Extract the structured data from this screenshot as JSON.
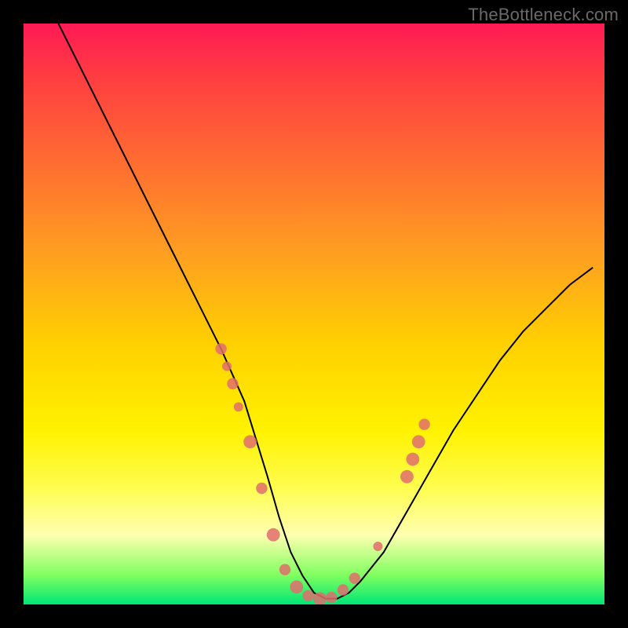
{
  "watermark": "TheBottleneck.com",
  "chart_data": {
    "type": "line",
    "title": "",
    "xlabel": "",
    "ylabel": "",
    "xlim": [
      0,
      100
    ],
    "ylim": [
      0,
      100
    ],
    "grid": false,
    "legend": false,
    "series": [
      {
        "name": "bottleneck-curve",
        "x": [
          6,
          10,
          14,
          18,
          22,
          26,
          30,
          34,
          38,
          42,
          44,
          46,
          48,
          50,
          52,
          54,
          56,
          58,
          62,
          66,
          70,
          74,
          78,
          82,
          86,
          90,
          94,
          98
        ],
        "y": [
          100,
          92,
          84,
          76,
          68,
          60,
          52,
          44,
          35,
          22,
          15,
          9,
          5,
          2,
          1,
          1,
          2,
          4,
          9,
          16,
          23,
          30,
          36,
          42,
          47,
          51,
          55,
          58
        ]
      }
    ],
    "highlight_points": {
      "name": "highlight-dots",
      "color": "#e06d6d",
      "points": [
        {
          "x": 34,
          "y": 44,
          "r": 1.2
        },
        {
          "x": 35,
          "y": 41,
          "r": 1.0
        },
        {
          "x": 36,
          "y": 38,
          "r": 1.2
        },
        {
          "x": 37,
          "y": 34,
          "r": 1.0
        },
        {
          "x": 39,
          "y": 28,
          "r": 1.4
        },
        {
          "x": 41,
          "y": 20,
          "r": 1.2
        },
        {
          "x": 43,
          "y": 12,
          "r": 1.4
        },
        {
          "x": 45,
          "y": 6,
          "r": 1.2
        },
        {
          "x": 47,
          "y": 3,
          "r": 1.4
        },
        {
          "x": 49,
          "y": 1.5,
          "r": 1.2
        },
        {
          "x": 51,
          "y": 1,
          "r": 1.4
        },
        {
          "x": 53,
          "y": 1.2,
          "r": 1.2
        },
        {
          "x": 55,
          "y": 2.5,
          "r": 1.2
        },
        {
          "x": 57,
          "y": 4.5,
          "r": 1.2
        },
        {
          "x": 61,
          "y": 10,
          "r": 1.0
        },
        {
          "x": 66,
          "y": 22,
          "r": 1.4
        },
        {
          "x": 67,
          "y": 25,
          "r": 1.4
        },
        {
          "x": 68,
          "y": 28,
          "r": 1.4
        },
        {
          "x": 69,
          "y": 31,
          "r": 1.2
        }
      ]
    }
  }
}
